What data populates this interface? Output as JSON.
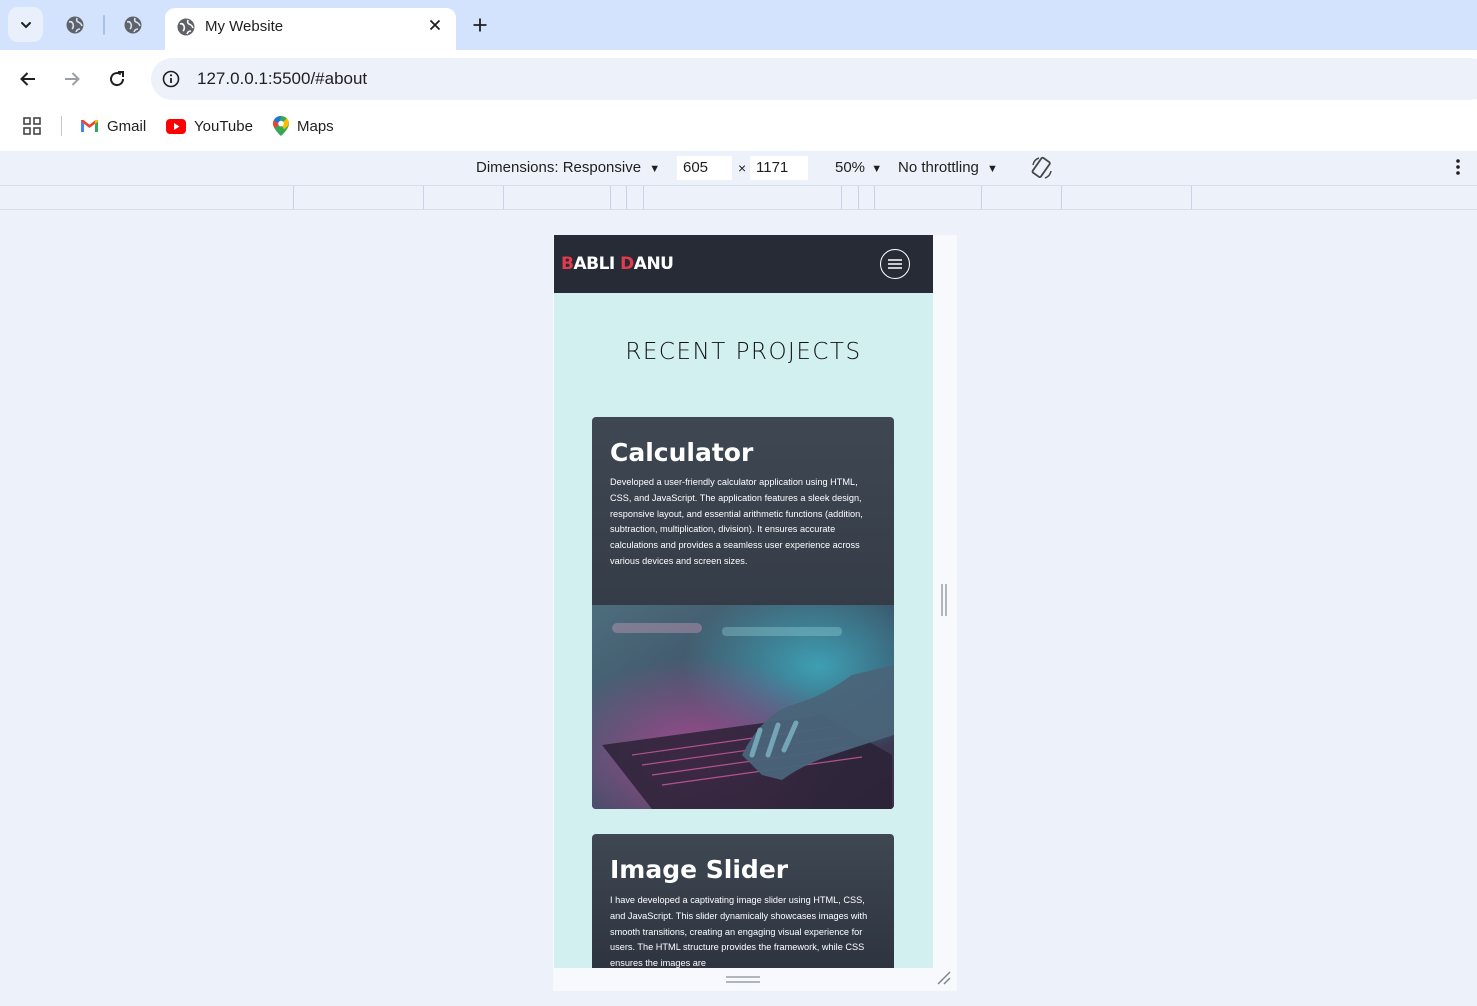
{
  "browser": {
    "active_tab_title": "My Website",
    "url": "127.0.0.1:5500/#about",
    "bookmarks": [
      {
        "label": "Gmail",
        "icon": "gmail-icon"
      },
      {
        "label": "YouTube",
        "icon": "youtube-icon"
      },
      {
        "label": "Maps",
        "icon": "maps-icon"
      }
    ]
  },
  "devtools": {
    "dimensions_label": "Dimensions: Responsive",
    "width": "605",
    "height": "1171",
    "times": "×",
    "zoom": "50%",
    "throttling": "No throttling"
  },
  "site": {
    "logo_first_initial": "B",
    "logo_first_rest": "ABLI",
    "logo_second_initial": "D",
    "logo_second_rest": "ANU",
    "section_title": "RECENT PROJECTS",
    "projects": [
      {
        "title": "Calculator",
        "description": "Developed a user-friendly calculator application using HTML, CSS, and JavaScript. The application features a sleek design, responsive layout, and essential arithmetic functions (addition, subtraction, multiplication, division). It ensures accurate calculations and provides a seamless user experience across various devices and screen sizes."
      },
      {
        "title": "Image Slider",
        "description": "I have developed a captivating image slider using HTML, CSS, and JavaScript. This slider dynamically showcases images with smooth transitions, creating an engaging visual experience for users. The HTML structure provides the framework, while CSS ensures the images are"
      }
    ]
  },
  "colors": {
    "accent_red": "#e23a4f",
    "nav_bg": "#272b36",
    "page_bg": "#d3f0f1"
  }
}
